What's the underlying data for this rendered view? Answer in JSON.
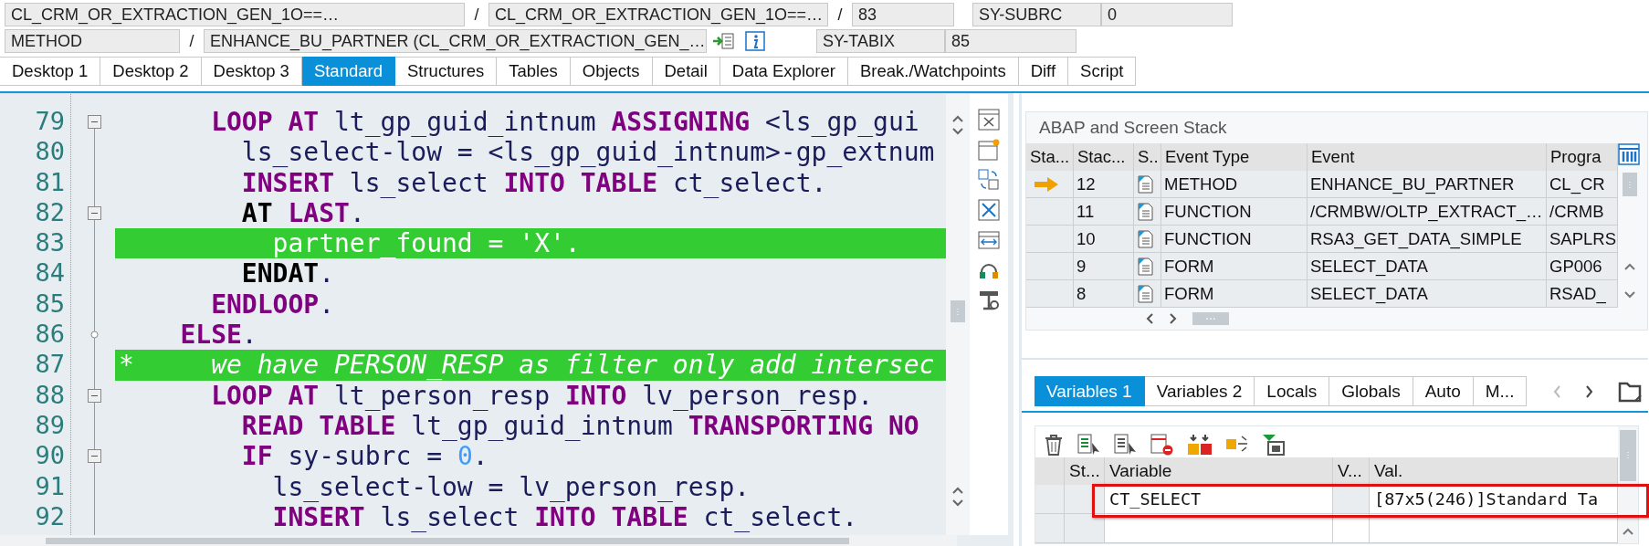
{
  "header": {
    "program": "CL_CRM_OR_EXTRACTION_GEN_1O==…",
    "include": "CL_CRM_OR_EXTRACTION_GEN_1O==…",
    "line": "83",
    "event_type": "METHOD",
    "event": "ENHANCE_BU_PARTNER (CL_CRM_OR_EXTRACTION_GEN_…",
    "separators": [
      "/",
      "/",
      "/"
    ],
    "sys_fields": [
      {
        "name": "SY-SUBRC",
        "value": "0"
      },
      {
        "name": "SY-TABIX",
        "value": "85"
      }
    ]
  },
  "tabs": [
    {
      "label": "Desktop 1",
      "selected": false
    },
    {
      "label": "Desktop 2",
      "selected": false
    },
    {
      "label": "Desktop 3",
      "selected": false
    },
    {
      "label": "Standard",
      "selected": true
    },
    {
      "label": "Structures",
      "selected": false
    },
    {
      "label": "Tables",
      "selected": false
    },
    {
      "label": "Objects",
      "selected": false
    },
    {
      "label": "Detail",
      "selected": false
    },
    {
      "label": "Data Explorer",
      "selected": false
    },
    {
      "label": "Break./Watchpoints",
      "selected": false
    },
    {
      "label": "Diff",
      "selected": false
    },
    {
      "label": "Script",
      "selected": false
    }
  ],
  "code": {
    "lines": [
      {
        "number": "79",
        "collapsible": true,
        "branch": false,
        "highlighted": false,
        "tokens": [
          {
            "kind": "keyword",
            "text": "      LOOP AT"
          },
          {
            "kind": "ident",
            "text": " lt_gp_guid_intnum "
          },
          {
            "kind": "keyword",
            "text": "ASSIGNING"
          },
          {
            "kind": "ident",
            "text": " <ls_gp_gui"
          }
        ]
      },
      {
        "number": "80",
        "collapsible": false,
        "branch": false,
        "highlighted": false,
        "tokens": [
          {
            "kind": "ident",
            "text": "        ls_select-low = <ls_gp_guid_intnum>-gp_extnum"
          }
        ]
      },
      {
        "number": "81",
        "collapsible": false,
        "branch": false,
        "highlighted": false,
        "tokens": [
          {
            "kind": "keyword",
            "text": "        INSERT"
          },
          {
            "kind": "ident",
            "text": " ls_select "
          },
          {
            "kind": "keyword",
            "text": "INTO TABLE"
          },
          {
            "kind": "ident",
            "text": " ct_select."
          }
        ]
      },
      {
        "number": "82",
        "collapsible": true,
        "branch": false,
        "highlighted": false,
        "tokens": [
          {
            "kind": "control",
            "text": "        AT "
          },
          {
            "kind": "keyword",
            "text": "LAST"
          },
          {
            "kind": "ident",
            "text": "."
          }
        ]
      },
      {
        "number": "83",
        "collapsible": false,
        "branch": false,
        "highlighted": true,
        "tokens": [
          {
            "kind": "ident",
            "text": "          partner_found = 'X'."
          }
        ]
      },
      {
        "number": "84",
        "collapsible": false,
        "branch": false,
        "highlighted": false,
        "tokens": [
          {
            "kind": "control",
            "text": "        ENDAT"
          },
          {
            "kind": "ident",
            "text": "."
          }
        ]
      },
      {
        "number": "85",
        "collapsible": false,
        "branch": false,
        "highlighted": false,
        "tokens": [
          {
            "kind": "keyword",
            "text": "      ENDLOOP"
          },
          {
            "kind": "ident",
            "text": "."
          }
        ]
      },
      {
        "number": "86",
        "collapsible": false,
        "branch": true,
        "highlighted": false,
        "tokens": [
          {
            "kind": "keyword",
            "text": "    ELSE"
          },
          {
            "kind": "ident",
            "text": "."
          }
        ]
      },
      {
        "number": "87",
        "collapsible": false,
        "branch": false,
        "highlighted": true,
        "tokens": [
          {
            "kind": "comment",
            "text": "*     we have PERSON_RESP as filter only add intersec"
          }
        ]
      },
      {
        "number": "88",
        "collapsible": true,
        "branch": false,
        "highlighted": false,
        "tokens": [
          {
            "kind": "keyword",
            "text": "      LOOP AT"
          },
          {
            "kind": "ident",
            "text": " lt_person_resp "
          },
          {
            "kind": "keyword",
            "text": "INTO"
          },
          {
            "kind": "ident",
            "text": " lv_person_resp."
          }
        ]
      },
      {
        "number": "89",
        "collapsible": false,
        "branch": false,
        "highlighted": false,
        "tokens": [
          {
            "kind": "keyword",
            "text": "        READ TABLE"
          },
          {
            "kind": "ident",
            "text": " lt_gp_guid_intnum "
          },
          {
            "kind": "keyword",
            "text": "TRANSPORTING NO"
          }
        ]
      },
      {
        "number": "90",
        "collapsible": true,
        "branch": false,
        "highlighted": false,
        "tokens": [
          {
            "kind": "keyword",
            "text": "        IF"
          },
          {
            "kind": "ident",
            "text": " sy-subrc = "
          },
          {
            "kind": "number",
            "text": "0"
          },
          {
            "kind": "ident",
            "text": "."
          }
        ]
      },
      {
        "number": "91",
        "collapsible": false,
        "branch": false,
        "highlighted": false,
        "tokens": [
          {
            "kind": "ident",
            "text": "          ls_select-low = lv_person_resp."
          }
        ]
      },
      {
        "number": "92",
        "collapsible": false,
        "branch": false,
        "highlighted": false,
        "tokens": [
          {
            "kind": "keyword",
            "text": "          INSERT"
          },
          {
            "kind": "ident",
            "text": " ls_select "
          },
          {
            "kind": "keyword",
            "text": "INTO TABLE"
          },
          {
            "kind": "ident",
            "text": " ct_select."
          }
        ]
      }
    ]
  },
  "stack": {
    "title": "ABAP and Screen Stack",
    "columns": [
      "Sta...",
      "Stac...",
      "S..",
      "Event Type",
      "Event",
      "Progra"
    ],
    "rows": [
      {
        "current": true,
        "level": "12",
        "event_type": "METHOD",
        "event": "ENHANCE_BU_PARTNER",
        "program": "CL_CR"
      },
      {
        "current": false,
        "level": "11",
        "event_type": "FUNCTION",
        "event": "/CRMBW/OLTP_EXTRACT_…",
        "program": "/CRMB"
      },
      {
        "current": false,
        "level": "10",
        "event_type": "FUNCTION",
        "event": "RSA3_GET_DATA_SIMPLE",
        "program": "SAPLRS"
      },
      {
        "current": false,
        "level": "9",
        "event_type": "FORM",
        "event": "SELECT_DATA",
        "program": "GP006"
      },
      {
        "current": false,
        "level": "8",
        "event_type": "FORM",
        "event": "SELECT_DATA",
        "program": "RSAD_"
      }
    ],
    "scroll_label": "..."
  },
  "variables": {
    "tabs": [
      {
        "label": "Variables 1",
        "selected": true
      },
      {
        "label": "Variables 2",
        "selected": false
      },
      {
        "label": "Locals",
        "selected": false
      },
      {
        "label": "Globals",
        "selected": false
      },
      {
        "label": "Auto",
        "selected": false
      },
      {
        "label": "M...",
        "selected": false
      }
    ],
    "columns": [
      "St...",
      "Variable",
      "V...",
      "Val."
    ],
    "rows": [
      {
        "variable": "CT_SELECT",
        "value": "[87x5(246)]Standard Ta",
        "outlined": true
      }
    ]
  }
}
